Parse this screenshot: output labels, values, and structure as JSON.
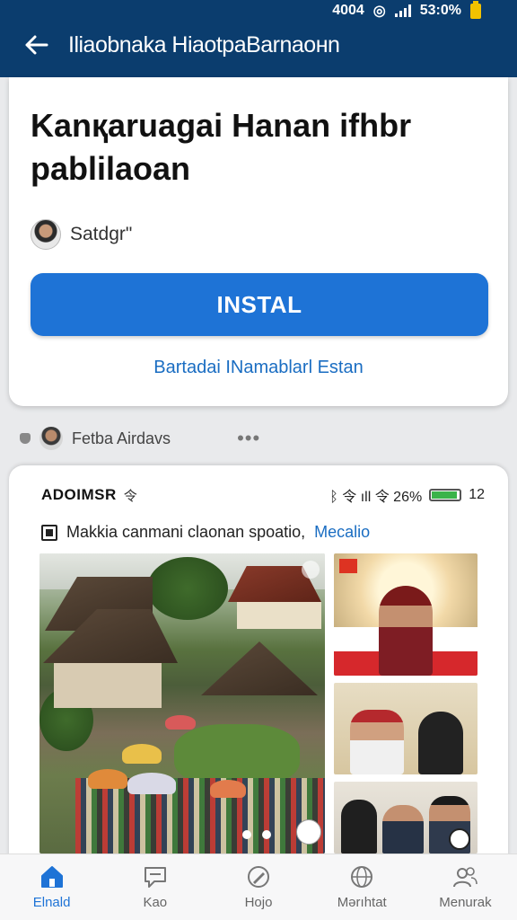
{
  "status_bar": {
    "left_text": "4004",
    "battery": "53:0%"
  },
  "app_bar": {
    "title": "Iliaobnaka HiaotpaBarnaoнn"
  },
  "app": {
    "title": "Kanқaruagai Hanan ifhbr pablilaoan",
    "developer": "Satdgr\"",
    "install_label": "INSTAL",
    "secondary_link": "Bartadai INamablarl Estan"
  },
  "publisher": {
    "name": "Fetba Airdavs",
    "more": "•••"
  },
  "screenshot": {
    "status_left": "ADOIMSR",
    "status_right": "ᛒ 令 ıll 令 26% ",
    "status_time": "12",
    "caption": "Makkia canmani claonan spoatio,",
    "caption_link": "Mecalio"
  },
  "bottom_nav": [
    {
      "label": "Elnald",
      "icon": "home-icon",
      "active": true
    },
    {
      "label": "Kao",
      "icon": "chat-icon",
      "active": false
    },
    {
      "label": "Hojo",
      "icon": "edit-icon",
      "active": false
    },
    {
      "label": "Mərıhtat",
      "icon": "globe-icon",
      "active": false
    },
    {
      "label": "Menurak",
      "icon": "people-icon",
      "active": false
    }
  ],
  "colors": {
    "app_bar": "#0b3d6e",
    "accent": "#1e73d6",
    "link": "#1a6dc2"
  }
}
